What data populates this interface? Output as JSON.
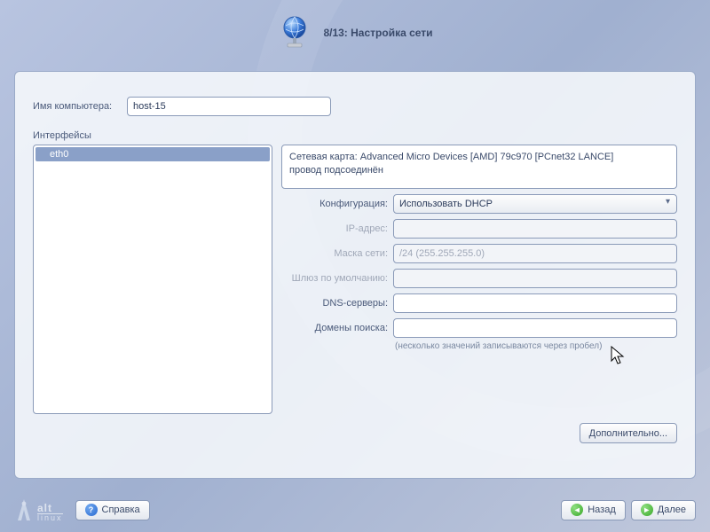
{
  "header": {
    "title": "8/13: Настройка сети"
  },
  "hostname": {
    "label": "Имя компьютера:",
    "value": "host-15"
  },
  "interfaces": {
    "label": "Интерфейсы",
    "items": [
      {
        "name": "eth0",
        "selected": true
      }
    ]
  },
  "info": {
    "line1": "Сетевая карта: Advanced Micro Devices [AMD] 79c970 [PCnet32 LANCE]",
    "line2": "провод подсоединён"
  },
  "form": {
    "config_label": "Конфигурация:",
    "config_value": "Использовать DHCP",
    "ip_label": "IP-адрес:",
    "ip_value": "",
    "mask_label": "Маска сети:",
    "mask_value": "/24 (255.255.255.0)",
    "gateway_label": "Шлюз по умолчанию:",
    "gateway_value": "",
    "dns_label": "DNS-серверы:",
    "dns_value": "",
    "search_label": "Домены поиска:",
    "search_value": "",
    "hint": "(несколько значений записываются через пробел)"
  },
  "buttons": {
    "more": "Дополнительно...",
    "help": "Справка",
    "back": "Назад",
    "next": "Далее"
  },
  "logo": {
    "line1": "alt",
    "line2": "linux"
  }
}
